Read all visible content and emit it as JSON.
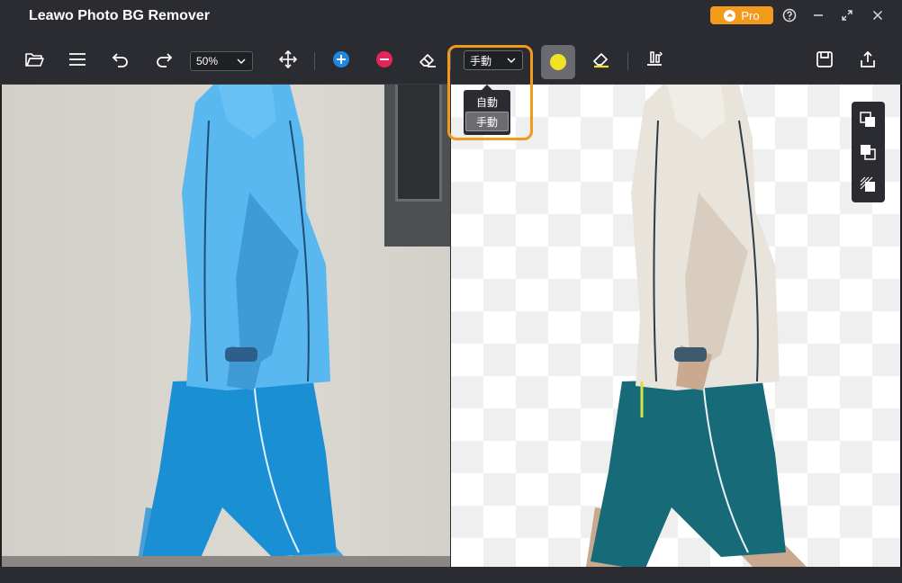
{
  "titlebar": {
    "title": "Leawo Photo BG Remover",
    "pro_label": "Pro",
    "pro_color": "#f39a1d"
  },
  "toolbar": {
    "zoom_value": "50%",
    "mode_value": "手動",
    "brush_color": "#f2e224"
  },
  "mode_dropdown": {
    "options": [
      "自動",
      "手動"
    ],
    "selected": "手動"
  },
  "icons": {
    "open": "folder-icon",
    "menu": "menu-icon",
    "undo": "undo-icon",
    "redo": "redo-icon",
    "move": "move-icon",
    "add": "plus-icon",
    "remove": "minus-icon",
    "erase": "eraser-icon",
    "brush_erase": "brush-eraser-icon",
    "stamp": "stamp-icon",
    "save": "save-icon",
    "export": "share-icon"
  },
  "colors": {
    "mask_blue": "#3fa9ee",
    "add_blue": "#1e88e5",
    "remove_red": "#e5245a",
    "accent_orange": "#f39a1d"
  }
}
